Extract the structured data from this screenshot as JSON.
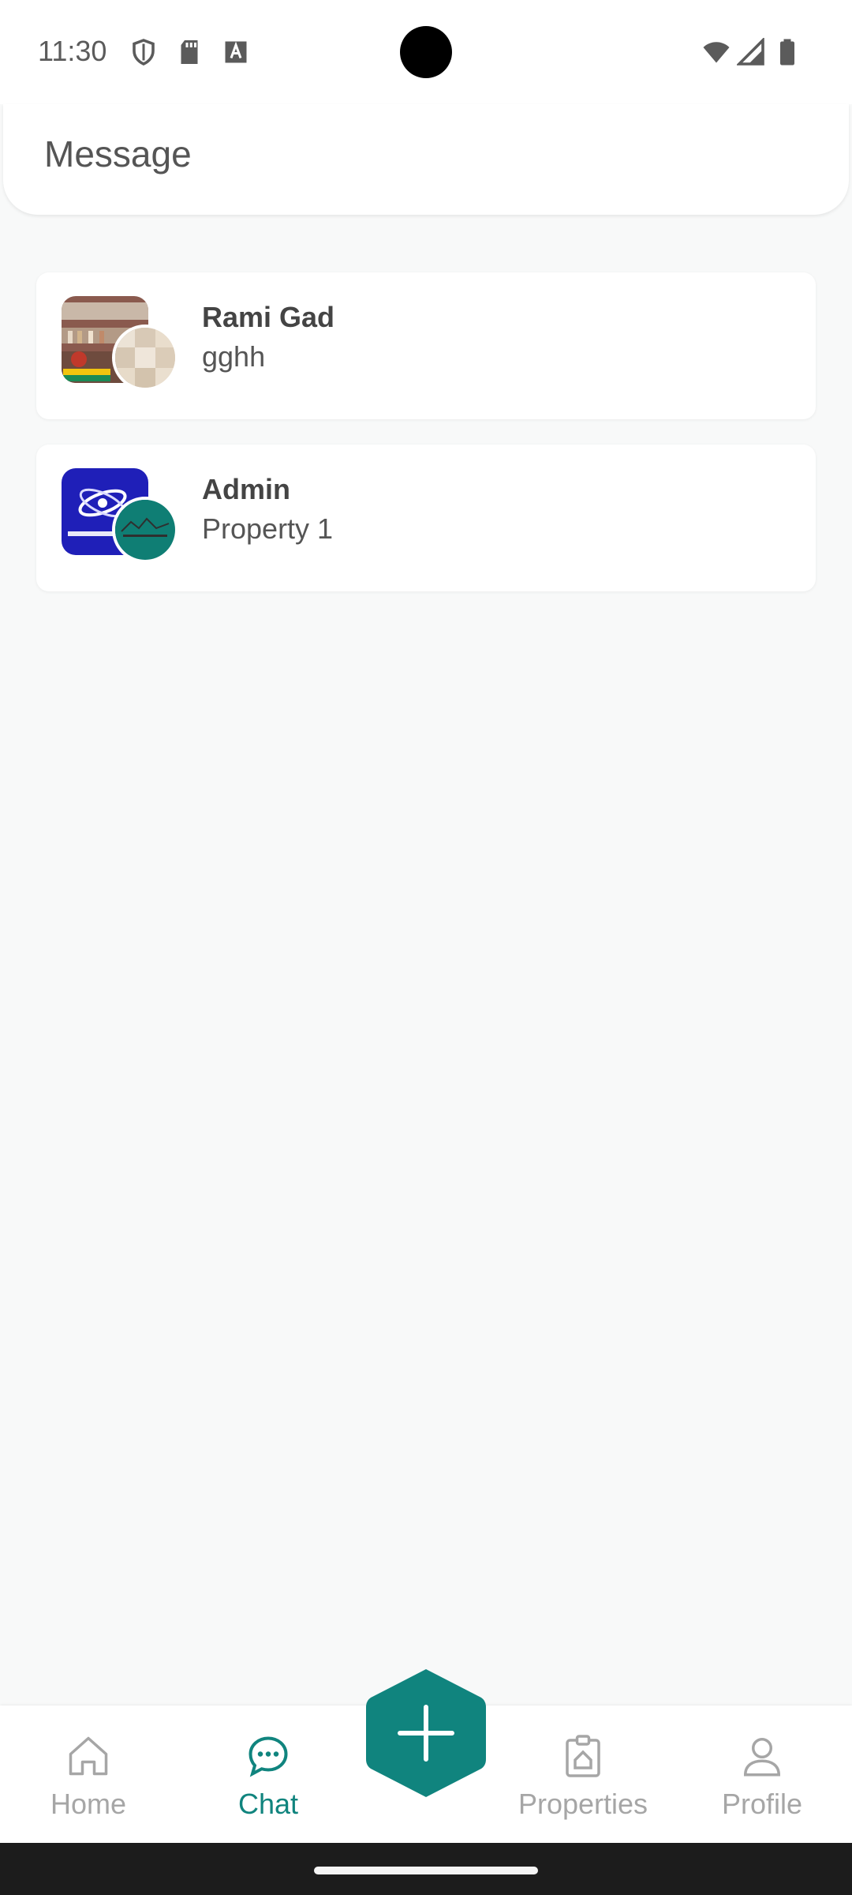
{
  "status_bar": {
    "time": "11:30"
  },
  "header": {
    "title": "Message"
  },
  "chats": [
    {
      "name": "Rami Gad",
      "preview": "gghh"
    },
    {
      "name": "Admin",
      "preview": "Property 1"
    }
  ],
  "nav": {
    "home": "Home",
    "chat": "Chat",
    "properties": "Properties",
    "profile": "Profile"
  },
  "colors": {
    "accent": "#10847e",
    "inactive": "#a6a6a6"
  }
}
